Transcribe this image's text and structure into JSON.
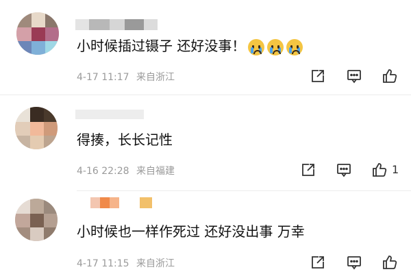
{
  "comments": [
    {
      "text": "小时候插过镊子 还好没事！",
      "emoji": [
        "crying-face-emoji",
        "crying-face-emoji",
        "crying-face-emoji"
      ],
      "time": "4-17 11:17",
      "location": "来自浙江",
      "like_count": ""
    },
    {
      "text": "得揍，长长记性",
      "time": "4-16 22:28",
      "location": "来自福建",
      "like_count": "1"
    },
    {
      "text": "小时候也一样作死过 还好没出事 万幸",
      "time": "4-17 11:15",
      "location": "来自浙江",
      "like_count": ""
    }
  ],
  "icons": {
    "share": "share-icon",
    "reply": "comment-icon",
    "like": "thumbs-up-icon"
  },
  "colors": {
    "text": "#111111",
    "meta": "#9a9a9a",
    "divider": "#ececec",
    "emoji": "#f4c542"
  }
}
